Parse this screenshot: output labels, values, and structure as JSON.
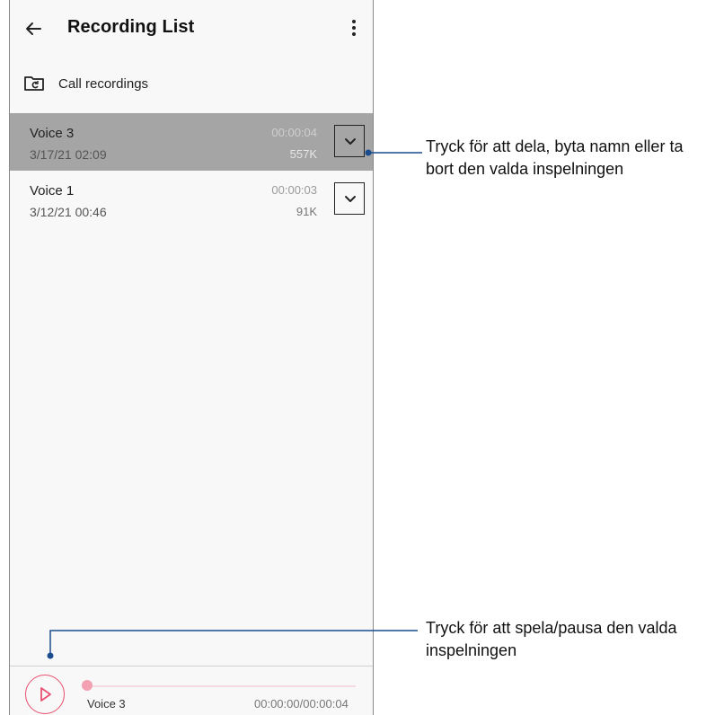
{
  "app_bar": {
    "title": "Recording List",
    "back_icon": "arrow-left-icon",
    "more_icon": "vertical-dots-icon"
  },
  "folder": {
    "icon": "folder-refresh-icon",
    "label": "Call recordings"
  },
  "recordings": [
    {
      "name": "Voice 3",
      "date": "3/17/21 02:09",
      "duration": "00:00:04",
      "size": "557K",
      "selected": true
    },
    {
      "name": "Voice 1",
      "date": "3/12/21 00:46",
      "duration": "00:00:03",
      "size": "91K",
      "selected": false
    }
  ],
  "player": {
    "track_name": "Voice 3",
    "time": "00:00:00/00:00:04",
    "progress": 0,
    "accent": "#e8506f"
  },
  "callouts": {
    "expand_line1": "Tryck för att dela, byta namn eller ta",
    "expand_line2": "bort den valda inspelningen",
    "play_line1": "Tryck för att spela/pausa den valda",
    "play_line2": "inspelningen"
  },
  "colors": {
    "selected_row": "#a5a5a5",
    "callout_line": "#1a4d8f"
  }
}
